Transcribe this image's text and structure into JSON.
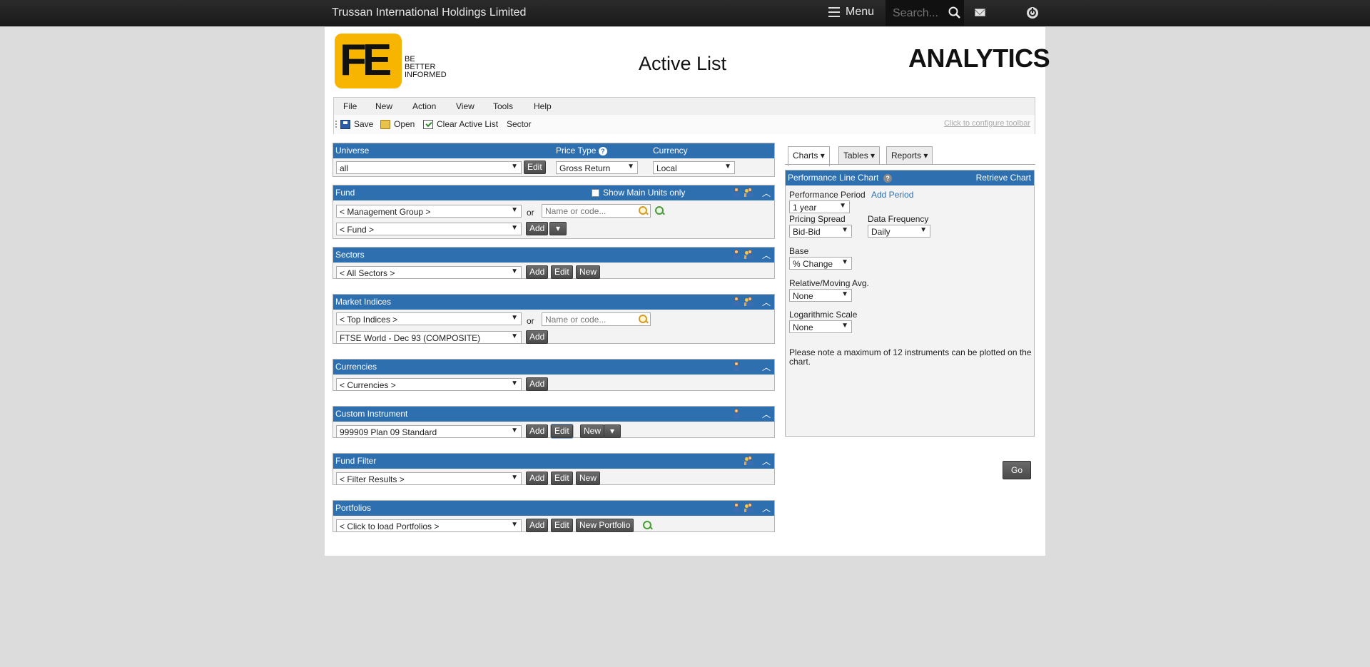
{
  "topbar": {
    "company": "Trussan International Holdings Limited",
    "menu_label": "Menu",
    "search_placeholder": "Search..."
  },
  "header": {
    "logo_text": "FE",
    "tagline": [
      "BE",
      "BETTER",
      "INFORMED"
    ],
    "title": "Active List",
    "brand": "ANALYTICS"
  },
  "menubar": {
    "items": [
      "File",
      "New",
      "Action",
      "View",
      "Tools",
      "Help"
    ],
    "toolbar": {
      "save": "Save",
      "open": "Open",
      "clear": "Clear Active List",
      "sector": "Sector",
      "configure": "Click to configure toolbar"
    }
  },
  "universe": {
    "universe_label": "Universe",
    "price_type_label": "Price Type",
    "currency_label": "Currency",
    "universe_value": "all",
    "edit": "Edit",
    "price_type_value": "Gross Return",
    "currency_value": "Local"
  },
  "fund": {
    "title": "Fund",
    "show_main_units": "Show Main Units only",
    "management_group": "< Management Group >",
    "or": "or",
    "name_placeholder": "Name or code...",
    "fund_select": "< Fund >",
    "add": "Add"
  },
  "sectors": {
    "title": "Sectors",
    "select": "< All Sectors >",
    "add": "Add",
    "edit": "Edit",
    "new": "New"
  },
  "market_indices": {
    "title": "Market Indices",
    "top_indices": "< Top Indices >",
    "or": "or",
    "name_placeholder": "Name or code...",
    "ftse": "FTSE World - Dec 93 (COMPOSITE)",
    "add": "Add"
  },
  "currencies": {
    "title": "Currencies",
    "select": "< Currencies >",
    "add": "Add"
  },
  "custom_instrument": {
    "title": "Custom Instrument",
    "select": "999909 Plan 09 Standard",
    "add": "Add",
    "edit": "Edit",
    "new": "New"
  },
  "fund_filter": {
    "title": "Fund Filter",
    "select": "< Filter Results >",
    "add": "Add",
    "edit": "Edit",
    "new": "New"
  },
  "portfolios": {
    "title": "Portfolios",
    "select": "< Click to load Portfolios >",
    "add": "Add",
    "edit": "Edit",
    "new_portfolio": "New Portfolio"
  },
  "tabs": {
    "charts": "Charts",
    "tables": "Tables",
    "reports": "Reports"
  },
  "chart_panel": {
    "title": "Performance Line Chart",
    "retrieve": "Retrieve Chart",
    "performance_period_label": "Performance Period",
    "add_period": "Add Period",
    "performance_period_value": "1 year",
    "pricing_spread_label": "Pricing Spread",
    "pricing_spread_value": "Bid-Bid",
    "data_frequency_label": "Data Frequency",
    "data_frequency_value": "Daily",
    "base_label": "Base",
    "base_value": "% Change",
    "relative_label": "Relative/Moving Avg.",
    "relative_value": "None",
    "log_label": "Logarithmic Scale",
    "log_value": "None",
    "note": "Please note a maximum of 12 instruments can be plotted on the chart."
  },
  "go": "Go",
  "colors": {
    "section_header": "#2e6fb0",
    "logo_yellow": "#f7b500",
    "topbar": "#1f1f1f"
  }
}
